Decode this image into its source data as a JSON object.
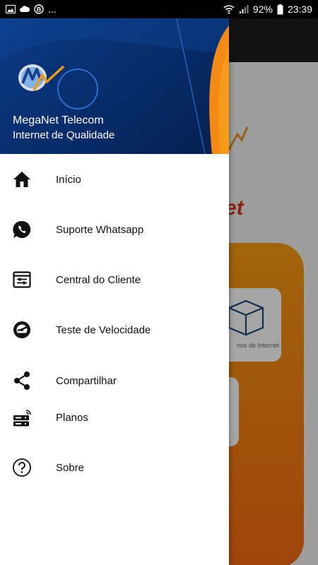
{
  "status_bar": {
    "battery": "92%",
    "time": "23:39",
    "ellipsis": "..."
  },
  "header": {
    "brand_name": "MegaNet Telecom",
    "tagline": "Internet de Qualidade"
  },
  "menu": [
    {
      "label": "Início",
      "icon": "home-icon"
    },
    {
      "label": "Suporte Whatsapp",
      "icon": "whatsapp-icon"
    },
    {
      "label": "Central do Cliente",
      "icon": "client-panel-icon"
    },
    {
      "label": "Teste de Velocidade",
      "icon": "speedometer-icon"
    },
    {
      "label": "Compartilhar",
      "icon": "share-icon"
    },
    {
      "label": "Planos",
      "icon": "server-icon"
    },
    {
      "label": "Sobre",
      "icon": "help-icon"
    }
  ],
  "background": {
    "brand_text": "et",
    "tile_label": "nos de Internet"
  },
  "colors": {
    "header_blue": "#0b3b86",
    "accent_orange": "#f58a12",
    "brand_red": "#d9351a"
  }
}
